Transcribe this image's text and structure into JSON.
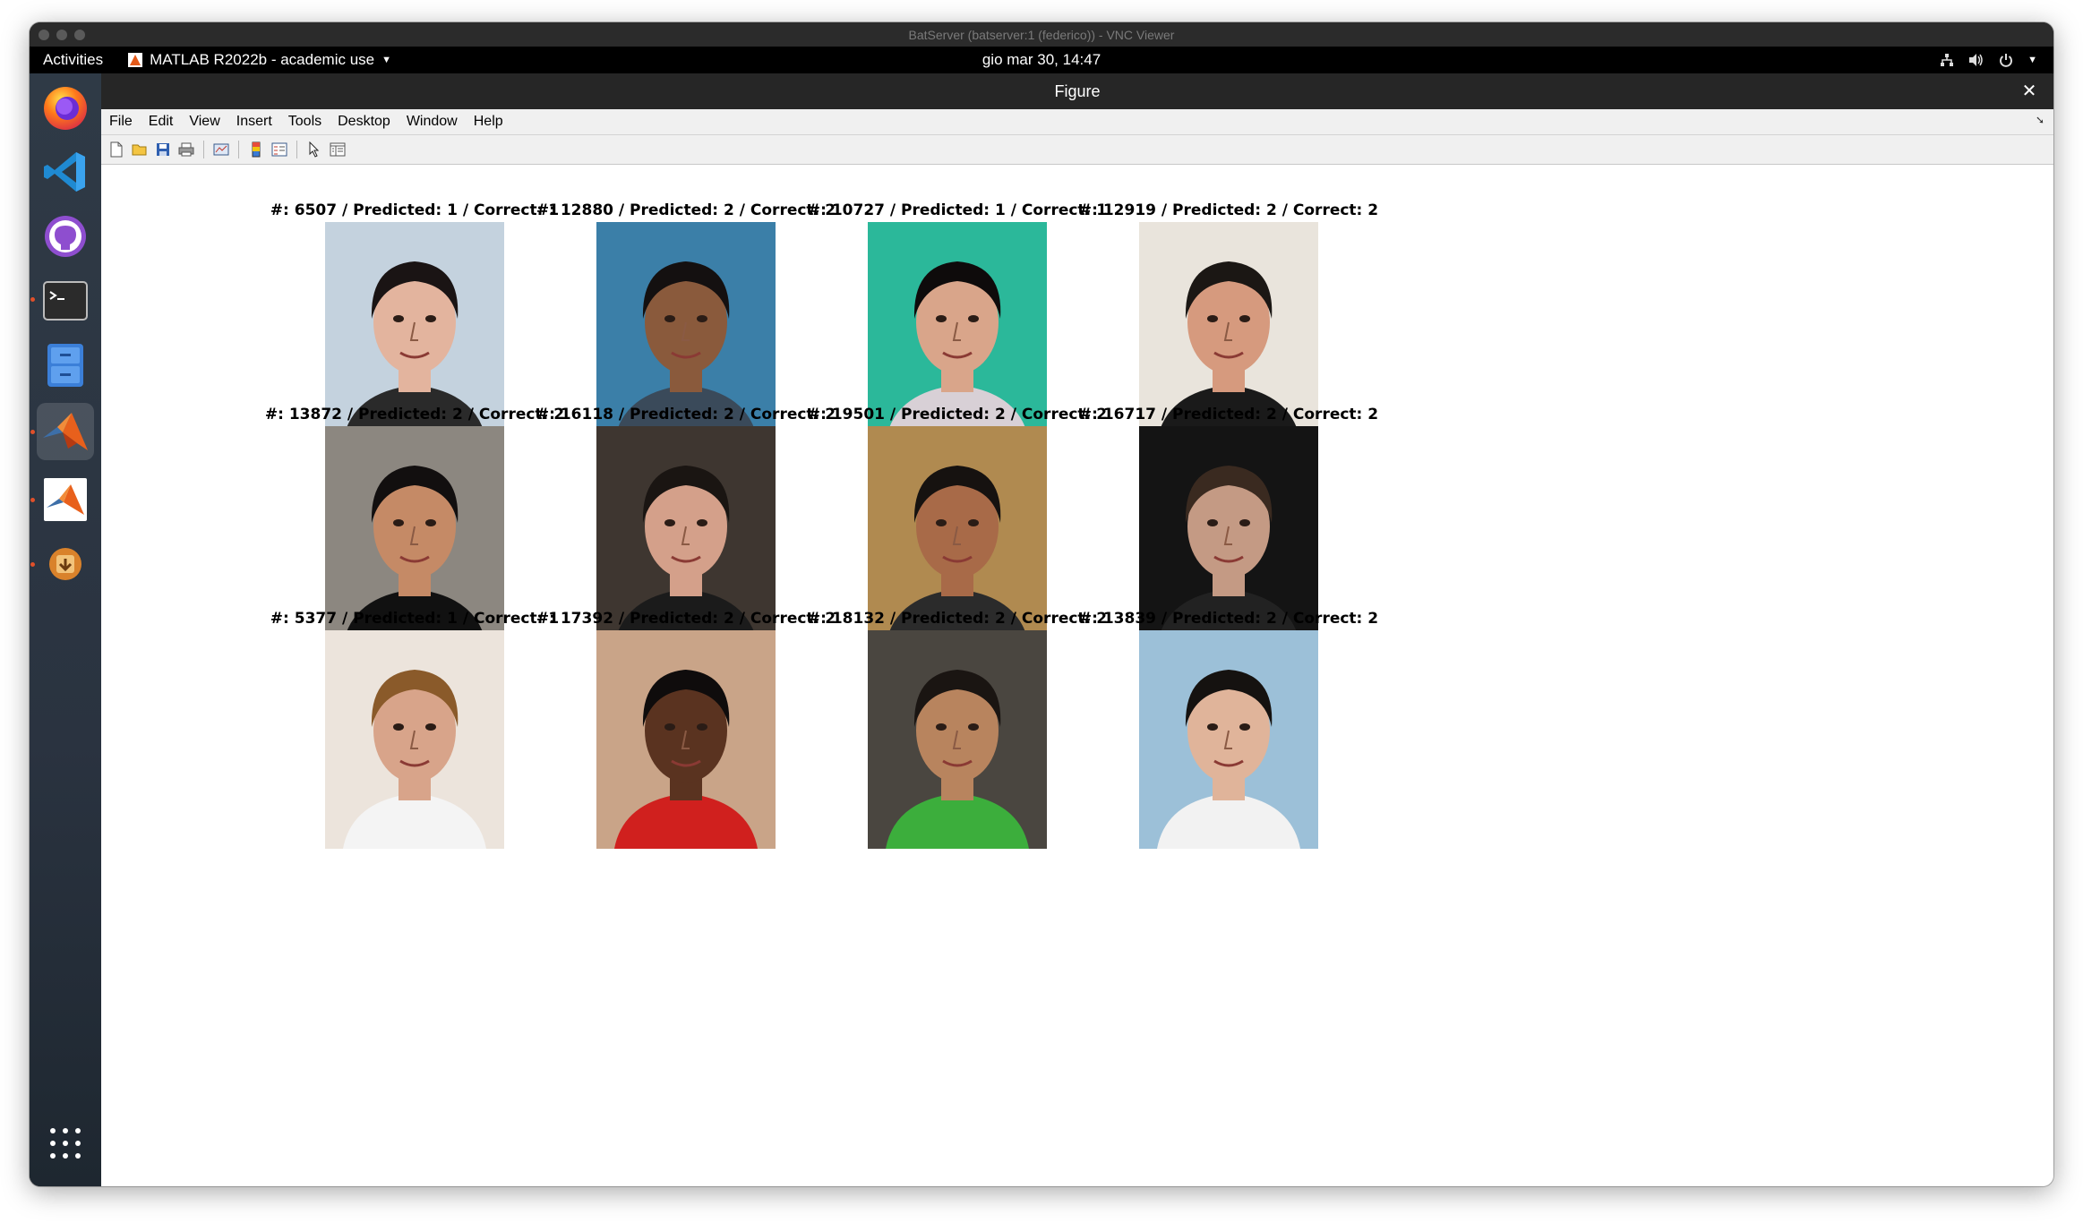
{
  "vnc": {
    "title": "BatServer (batserver:1 (federico)) - VNC Viewer"
  },
  "gnome": {
    "activities": "Activities",
    "app_menu": "MATLAB R2022b - academic use",
    "clock": "gio mar 30, 14:47"
  },
  "dock": {
    "items": [
      "firefox",
      "vscode",
      "github-desktop",
      "terminal",
      "files",
      "matlab",
      "matlab",
      "software-updater"
    ]
  },
  "figure": {
    "title": "Figure",
    "menu": [
      "File",
      "Edit",
      "View",
      "Insert",
      "Tools",
      "Desktop",
      "Window",
      "Help"
    ],
    "panels": [
      {
        "title": "#: 6507 / Predicted: 1 / Correct: 1"
      },
      {
        "title": "#: 12880 / Predicted: 2 / Correct: 2"
      },
      {
        "title": "#: 10727 / Predicted: 1 / Correct: 1"
      },
      {
        "title": "#: 12919 / Predicted: 2 / Correct: 2"
      },
      {
        "title": "#: 13872 / Predicted: 2 / Correct: 2"
      },
      {
        "title": "#: 16118 / Predicted: 2 / Correct: 2"
      },
      {
        "title": "#: 19501 / Predicted: 2 / Correct: 2"
      },
      {
        "title": "#: 16717 / Predicted: 2 / Correct: 2"
      },
      {
        "title": "#: 5377 / Predicted: 1 / Correct: 1"
      },
      {
        "title": "#: 17392 / Predicted: 2 / Correct: 2"
      },
      {
        "title": "#: 18132 / Predicted: 2 / Correct: 2"
      },
      {
        "title": "#: 13839 / Predicted: 2 / Correct: 2"
      }
    ]
  }
}
